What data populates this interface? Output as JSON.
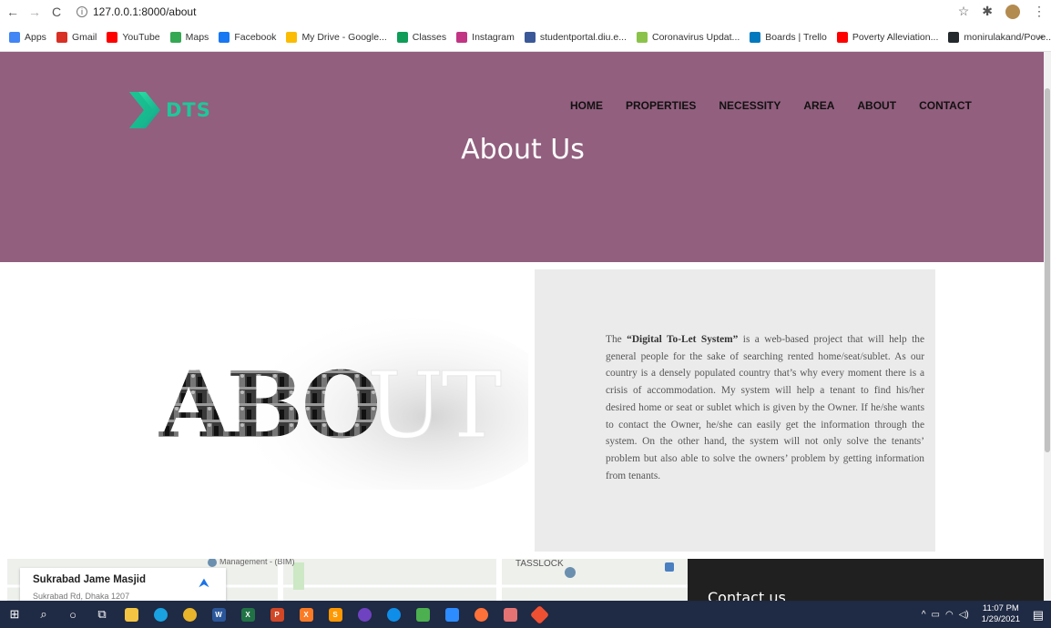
{
  "browser": {
    "url": "127.0.0.1:8000/about",
    "bookmarks": [
      {
        "label": "Apps",
        "icon": "apps-icon",
        "color": "#4285f4"
      },
      {
        "label": "Gmail",
        "icon": "gmail-icon",
        "color": "#d93025"
      },
      {
        "label": "YouTube",
        "icon": "youtube-icon",
        "color": "#ff0000"
      },
      {
        "label": "Maps",
        "icon": "maps-icon",
        "color": "#34a853"
      },
      {
        "label": "Facebook",
        "icon": "facebook-icon",
        "color": "#1877f2"
      },
      {
        "label": "My Drive - Google...",
        "icon": "drive-icon",
        "color": "#fbbc04"
      },
      {
        "label": "Classes",
        "icon": "classes-icon",
        "color": "#0f9d58"
      },
      {
        "label": "Instagram",
        "icon": "instagram-icon",
        "color": "#c13584"
      },
      {
        "label": "studentportal.diu.e...",
        "icon": "studentportal-icon",
        "color": "#3b5998"
      },
      {
        "label": "Coronavirus Updat...",
        "icon": "coronavirus-icon",
        "color": "#8bc34a"
      },
      {
        "label": "Boards | Trello",
        "icon": "trello-icon",
        "color": "#0079bf"
      },
      {
        "label": "Poverty Alleviation...",
        "icon": "youtube-icon",
        "color": "#ff0000"
      },
      {
        "label": "monirulakand/Pove...",
        "icon": "github-icon",
        "color": "#24292e"
      }
    ]
  },
  "site": {
    "logo_text": "DTS",
    "nav": [
      "HOME",
      "PROPERTIES",
      "NECESSITY",
      "AREA",
      "ABOUT",
      "CONTACT"
    ],
    "hero_title": "About Us",
    "hero_color": "#925f7e",
    "accent": "#1fc79b"
  },
  "about": {
    "image_word": "ABOUT",
    "text_prefix": "The ",
    "text_bold": "“Digital To-Let System”",
    "text_body": " is a web-based project that will help the general people for the sake of searching rented home/seat/sublet. As our country is a densely populated country that’s why every moment there is a crisis of accommodation. My system will help a tenant to find his/her desired home or seat or sublet which is given by the Owner. If he/she wants to contact the Owner, he/she can easily get the information through the system. On the other hand, the system will not only solve the tenants’ problem but also able to solve the owners’ problem by getting information from tenants."
  },
  "map": {
    "place_title": "Sukrabad Jame Masjid",
    "place_address": "Sukrabad Rd, Dhaka 1207",
    "label_management": "Management - (BIM)",
    "label_tasslock": "TASSLOCK"
  },
  "contact": {
    "title": "Contact us"
  },
  "taskbar": {
    "time": "11:07 PM",
    "date": "1/29/2021"
  }
}
